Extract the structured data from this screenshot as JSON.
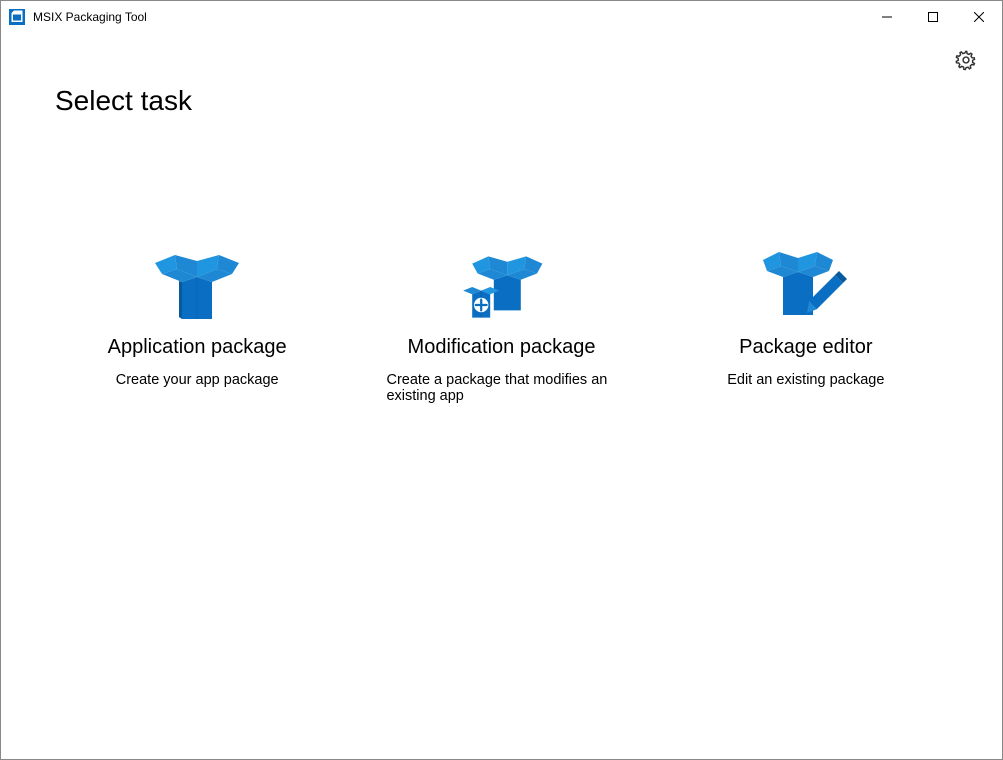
{
  "window": {
    "title": "MSIX Packaging Tool"
  },
  "page": {
    "heading": "Select task"
  },
  "tasks": [
    {
      "title": "Application package",
      "desc": "Create your app package"
    },
    {
      "title": "Modification package",
      "desc": "Create a package that modifies an existing app"
    },
    {
      "title": "Package editor",
      "desc": "Edit an existing package"
    }
  ],
  "colors": {
    "accent": "#0a6fc2"
  }
}
